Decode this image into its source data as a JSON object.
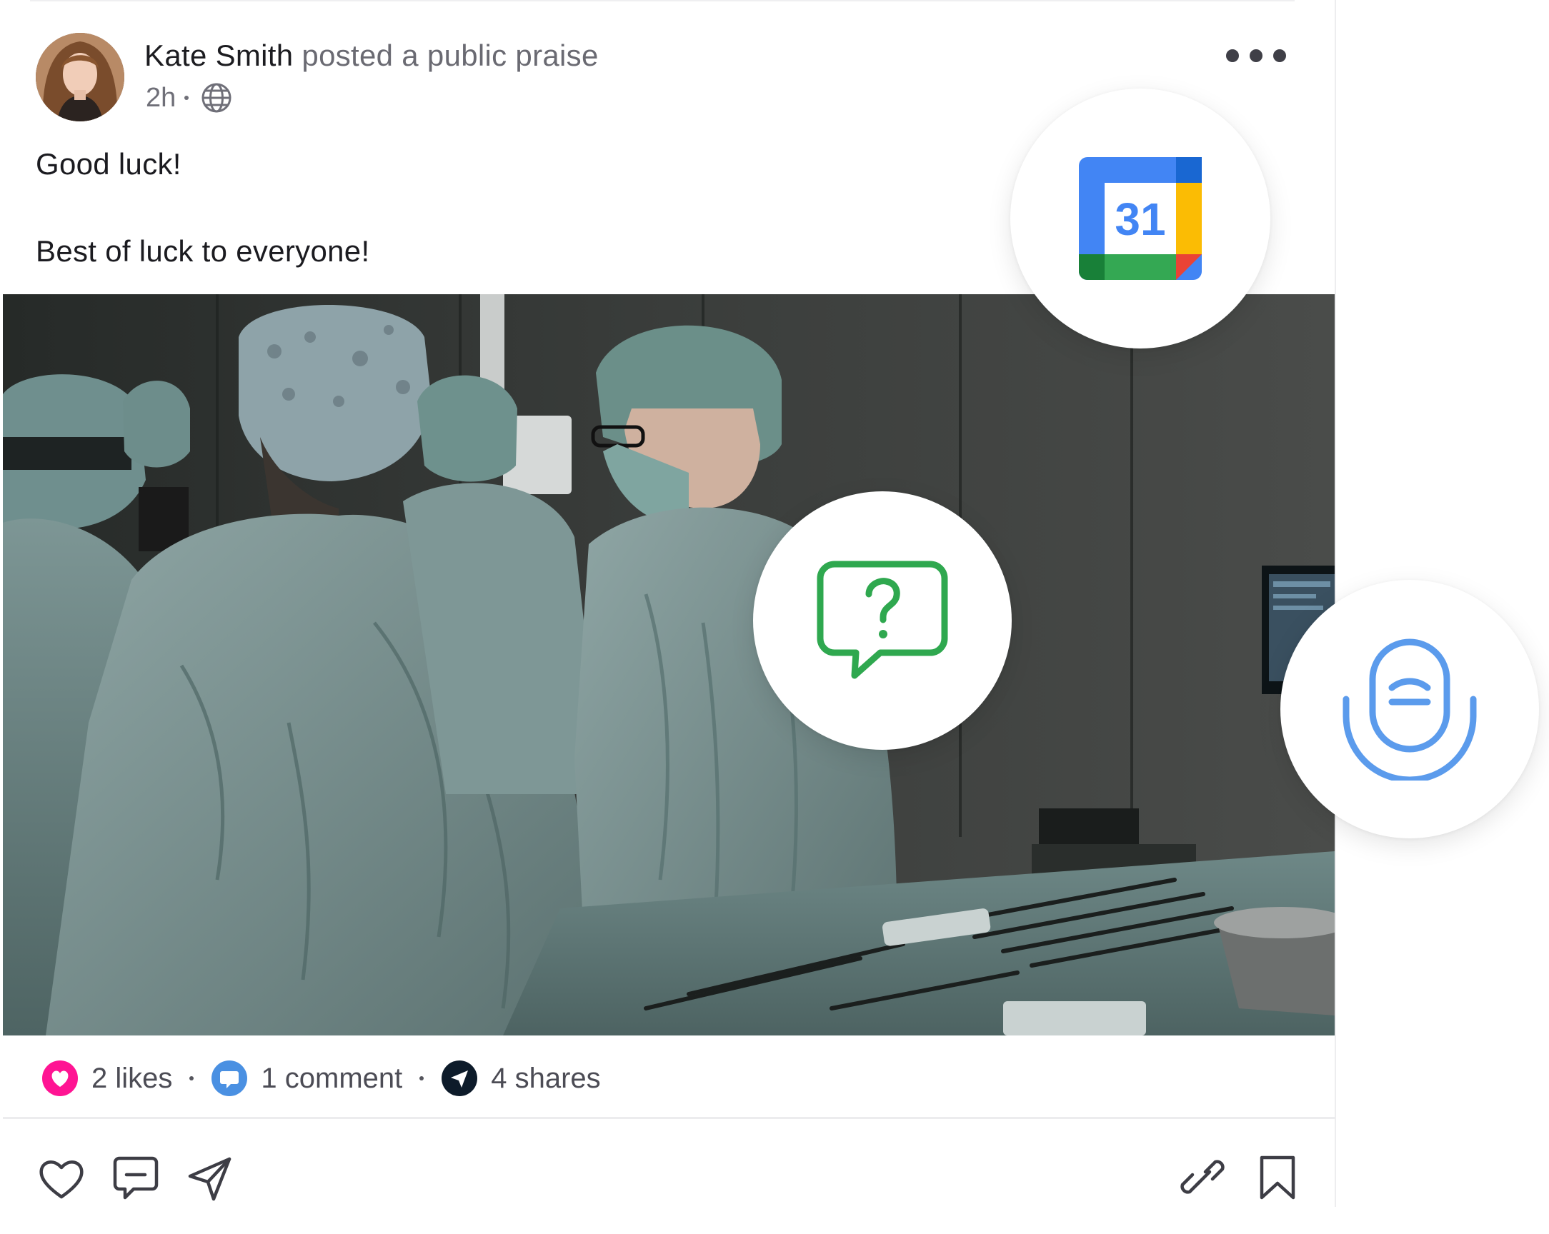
{
  "post": {
    "author": "Kate Smith",
    "action": "posted a public praise",
    "time": "2h",
    "visibility_icon": "globe-icon",
    "menu_icon": "more-horizontal-icon",
    "text_line1": "Good luck!",
    "text_line2": "Best of luck to everyone!",
    "image_description_icon": "photo"
  },
  "stats": {
    "likes": "2 likes",
    "comments": "1 comment",
    "shares": "4 shares",
    "like_color": "#ff1493",
    "comment_color": "#4a90e2",
    "share_color": "#0d1b2a"
  },
  "actions": {
    "left": [
      "heart-icon",
      "comment-icon",
      "send-icon"
    ],
    "right": [
      "link-icon",
      "bookmark-icon"
    ]
  },
  "integrations": {
    "calendar_day": "31",
    "calendar_colors": {
      "blue": "#4285f4",
      "dark_blue": "#1967d2",
      "yellow": "#fbbc04",
      "green": "#34a853",
      "dark_green": "#188038",
      "red": "#ea4335"
    },
    "question_color": "#2fa84f",
    "mic_color": "#5b9bec"
  }
}
